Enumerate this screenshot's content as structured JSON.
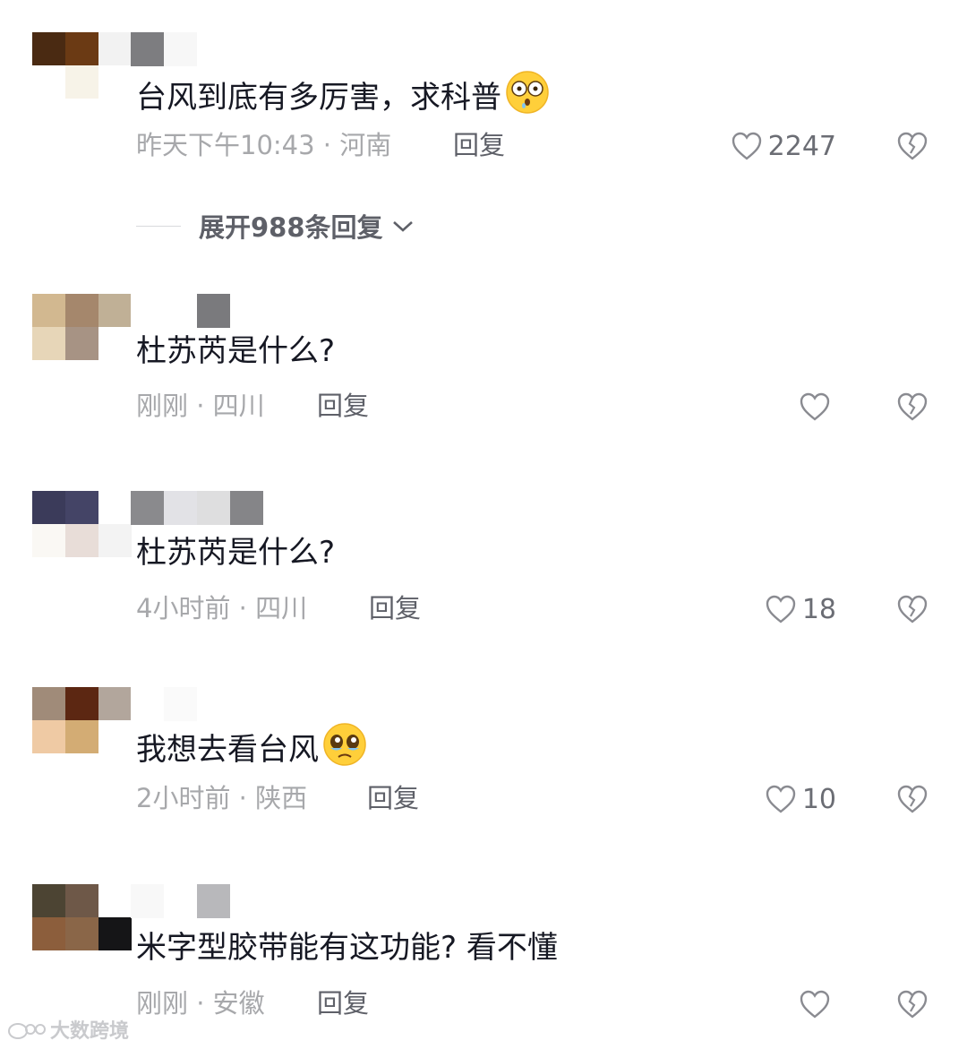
{
  "comments": [
    {
      "text": "台风到底有多厉害，求科普",
      "emoji": "dizzy-face-emoji",
      "time_location": "昨天下午10:43 · 河南",
      "reply_label": "回复",
      "likes": "2247",
      "avatar_colors": [
        "#4a2a12",
        "#6b3a14",
        "#f2f2f2",
        "#ffffff",
        "#f7f3e8",
        "#ffffff"
      ],
      "name_colors": [
        "#f0f0f2",
        "#7d7d80",
        "#ffffff"
      ]
    },
    {
      "text": "杜苏芮是什么?",
      "time_location": "刚刚 · 四川",
      "reply_label": "回复",
      "likes": "",
      "avatar_colors": [
        "#d2b890",
        "#a5876c",
        "#c0b096",
        "#e7d6b8",
        "#a79384",
        "#ffffff"
      ],
      "name_colors": [
        "#ffffff",
        "#ffffff",
        "#7a7a7d"
      ]
    },
    {
      "text": "杜苏芮是什么?",
      "time_location": "4小时前 · 四川",
      "reply_label": "回复",
      "likes": "18",
      "avatar_colors": [
        "#3b3b5a",
        "#444466",
        "#ffffff",
        "#faf8f4",
        "#e8ddd8",
        "#f3f3f3"
      ],
      "name_colors": [
        "#8a8a8d",
        "#e2e2e6",
        "#dededf",
        "#858588"
      ]
    },
    {
      "text": "我想去看台风",
      "emoji": "pleading-face-emoji",
      "time_location": "2小时前 · 陕西",
      "reply_label": "回复",
      "likes": "10",
      "avatar_colors": [
        "#a08b79",
        "#5c2712",
        "#b2a69c",
        "#efcaa4",
        "#d3ac74",
        "#ffffff"
      ],
      "name_colors": [
        "#ffffff",
        "#ffffff",
        "#fafafa"
      ]
    },
    {
      "text": "米字型胶带能有这功能? 看不懂",
      "time_location": "刚刚 · 安徽",
      "reply_label": "回复",
      "likes": "",
      "avatar_colors": [
        "#4c4433",
        "#6e5848",
        "#ffffff",
        "#8c5e3c",
        "#8a6648",
        "#151517"
      ],
      "name_colors": [
        "#f8f8f8",
        "#ffffff",
        "#b8b8bb"
      ]
    }
  ],
  "expand_replies_label": "展开988条回复",
  "watermark": "大数跨境",
  "colors": {
    "text": "#161823",
    "meta": "#a7a8ab",
    "reply": "#5e6068"
  }
}
